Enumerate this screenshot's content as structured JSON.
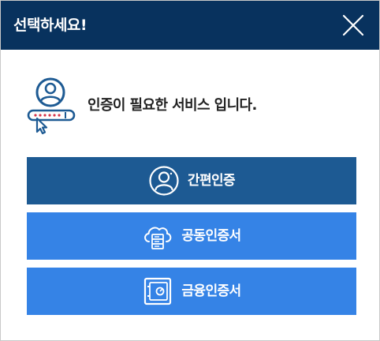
{
  "header": {
    "title": "선택하세요!"
  },
  "prompt": {
    "text": "인증이 필요한 서비스 입니다."
  },
  "buttons": [
    {
      "label": "간편인증",
      "icon": "user-circle-icon"
    },
    {
      "label": "공동인증서",
      "icon": "cloud-server-icon"
    },
    {
      "label": "금융인증서",
      "icon": "safe-icon"
    }
  ],
  "colors": {
    "header_bg": "#08325e",
    "primary_button": "#1d5a93",
    "secondary_button": "#3583e6",
    "icon_accent": "#1d5a93",
    "icon_alert": "#d6344a"
  }
}
